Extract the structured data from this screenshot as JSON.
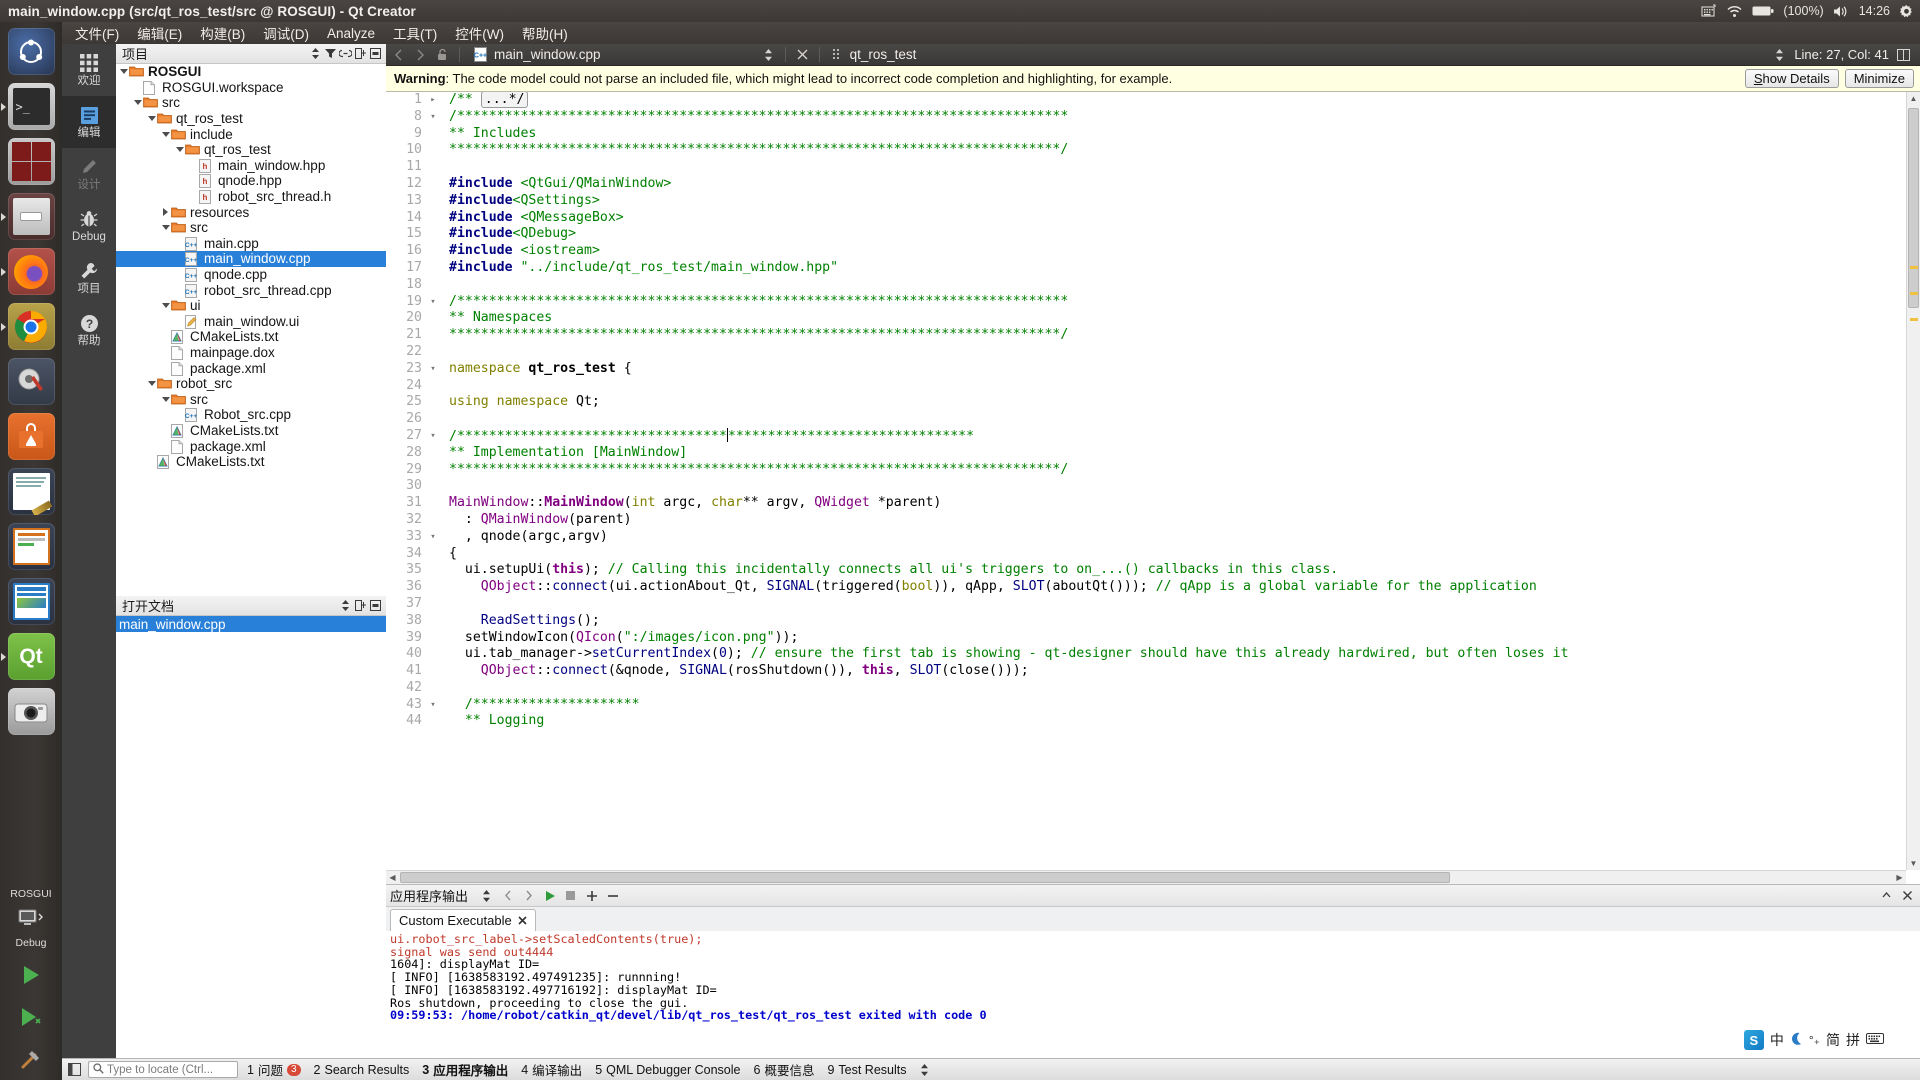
{
  "window": {
    "title": "main_window.cpp (src/qt_ros_test/src @ ROSGUI) - Qt Creator"
  },
  "tray": {
    "keyboard_icon": "keyboard-icon",
    "wifi_icon": "wifi-icon",
    "battery_icon": "battery-icon",
    "battery_label": "(100%)",
    "volume_icon": "volume-icon",
    "clock": "14:26",
    "gear_icon": "gear-icon"
  },
  "launcher": {
    "items": [
      {
        "name": "ubuntu-dash",
        "icon": "ubuntu-logo-icon",
        "running": false
      },
      {
        "name": "terminal",
        "icon": "terminal-icon",
        "running": true
      },
      {
        "name": "terminator",
        "icon": "terminator-icon",
        "running": false
      },
      {
        "name": "files",
        "icon": "file-manager-icon",
        "running": true
      },
      {
        "name": "firefox",
        "icon": "firefox-icon",
        "running": true
      },
      {
        "name": "chrome",
        "icon": "chrome-icon",
        "running": true
      },
      {
        "name": "software-updater",
        "icon": "gear-wrench-icon",
        "running": false
      },
      {
        "name": "ubuntu-software",
        "icon": "software-bag-icon",
        "running": false
      },
      {
        "name": "libreoffice-writer",
        "icon": "writer-icon",
        "running": false
      },
      {
        "name": "libreoffice-impress",
        "icon": "impress-icon",
        "running": false
      },
      {
        "name": "libreoffice-draw",
        "icon": "draw-icon",
        "running": false
      },
      {
        "name": "qt-creator",
        "icon": "qt-icon",
        "running": true
      },
      {
        "name": "camera",
        "icon": "camera-icon",
        "running": false
      }
    ],
    "bottom": {
      "project_label": "ROSGUI",
      "kit_label": "Debug",
      "run_icon": "run-icon",
      "debug_icon": "debug-run-icon",
      "build_icon": "build-hammer-icon"
    }
  },
  "menubar": {
    "items": [
      "文件(F)",
      "编辑(E)",
      "构建(B)",
      "调试(D)",
      "Analyze",
      "工具(T)",
      "控件(W)",
      "帮助(H)"
    ]
  },
  "modes": [
    {
      "label": "欢迎",
      "icon": "grid-icon",
      "state": "normal"
    },
    {
      "label": "编辑",
      "icon": "edit-doc-icon",
      "state": "active"
    },
    {
      "label": "设计",
      "icon": "pencil-icon",
      "state": "disabled"
    },
    {
      "label": "Debug",
      "icon": "bug-icon",
      "state": "normal"
    },
    {
      "label": "项目",
      "icon": "wrench-icon",
      "state": "normal"
    },
    {
      "label": "帮助",
      "icon": "question-icon",
      "state": "normal"
    }
  ],
  "project_dock": {
    "title": "项目",
    "filter_icon": "filter-icon",
    "link_icon": "link-icon",
    "split_icon": "split-icon",
    "close_icon": "close-icon",
    "tree": [
      {
        "depth": 0,
        "expander": "down",
        "icon": "folder-icon",
        "label": "ROSGUI",
        "bold": true,
        "selected": false
      },
      {
        "depth": 1,
        "expander": "none",
        "icon": "file-icon",
        "label": "ROSGUI.workspace",
        "bold": false,
        "selected": false
      },
      {
        "depth": 1,
        "expander": "down",
        "icon": "folder-icon",
        "label": "src",
        "bold": false,
        "selected": false
      },
      {
        "depth": 2,
        "expander": "down",
        "icon": "folder-icon",
        "label": "qt_ros_test",
        "bold": false,
        "selected": false
      },
      {
        "depth": 3,
        "expander": "down",
        "icon": "folder-icon",
        "label": "include",
        "bold": false,
        "selected": false
      },
      {
        "depth": 4,
        "expander": "down",
        "icon": "folder-icon",
        "label": "qt_ros_test",
        "bold": false,
        "selected": false
      },
      {
        "depth": 5,
        "expander": "none",
        "icon": "h-file-icon",
        "label": "main_window.hpp",
        "bold": false,
        "selected": false
      },
      {
        "depth": 5,
        "expander": "none",
        "icon": "h-file-icon",
        "label": "qnode.hpp",
        "bold": false,
        "selected": false
      },
      {
        "depth": 5,
        "expander": "none",
        "icon": "h-file-icon",
        "label": "robot_src_thread.h",
        "bold": false,
        "selected": false
      },
      {
        "depth": 3,
        "expander": "right",
        "icon": "folder-icon",
        "label": "resources",
        "bold": false,
        "selected": false
      },
      {
        "depth": 3,
        "expander": "down",
        "icon": "folder-icon",
        "label": "src",
        "bold": false,
        "selected": false
      },
      {
        "depth": 4,
        "expander": "none",
        "icon": "cpp-file-icon",
        "label": "main.cpp",
        "bold": false,
        "selected": false
      },
      {
        "depth": 4,
        "expander": "none",
        "icon": "cpp-file-icon",
        "label": "main_window.cpp",
        "bold": false,
        "selected": true
      },
      {
        "depth": 4,
        "expander": "none",
        "icon": "cpp-file-icon",
        "label": "qnode.cpp",
        "bold": false,
        "selected": false
      },
      {
        "depth": 4,
        "expander": "none",
        "icon": "cpp-file-icon",
        "label": "robot_src_thread.cpp",
        "bold": false,
        "selected": false
      },
      {
        "depth": 3,
        "expander": "down",
        "icon": "folder-icon",
        "label": "ui",
        "bold": false,
        "selected": false
      },
      {
        "depth": 4,
        "expander": "none",
        "icon": "ui-file-icon",
        "label": "main_window.ui",
        "bold": false,
        "selected": false
      },
      {
        "depth": 3,
        "expander": "none",
        "icon": "cmake-icon",
        "label": "CMakeLists.txt",
        "bold": false,
        "selected": false
      },
      {
        "depth": 3,
        "expander": "none",
        "icon": "file-icon",
        "label": "mainpage.dox",
        "bold": false,
        "selected": false
      },
      {
        "depth": 3,
        "expander": "none",
        "icon": "file-icon",
        "label": "package.xml",
        "bold": false,
        "selected": false
      },
      {
        "depth": 2,
        "expander": "down",
        "icon": "folder-icon",
        "label": "robot_src",
        "bold": false,
        "selected": false
      },
      {
        "depth": 3,
        "expander": "down",
        "icon": "folder-icon",
        "label": "src",
        "bold": false,
        "selected": false
      },
      {
        "depth": 4,
        "expander": "none",
        "icon": "cpp-file-icon",
        "label": "Robot_src.cpp",
        "bold": false,
        "selected": false
      },
      {
        "depth": 3,
        "expander": "none",
        "icon": "cmake-icon",
        "label": "CMakeLists.txt",
        "bold": false,
        "selected": false
      },
      {
        "depth": 3,
        "expander": "none",
        "icon": "file-icon",
        "label": "package.xml",
        "bold": false,
        "selected": false
      },
      {
        "depth": 2,
        "expander": "none",
        "icon": "cmake-icon",
        "label": "CMakeLists.txt",
        "bold": false,
        "selected": false
      }
    ]
  },
  "opendocs_dock": {
    "title": "打开文档",
    "items": [
      {
        "label": "main_window.cpp",
        "selected": true
      }
    ]
  },
  "editor_toolbar": {
    "back_icon": "back-arrow-icon",
    "forward_icon": "forward-arrow-icon",
    "lock_icon": "unlocked-icon",
    "file_icon": "cpp-file-icon",
    "filename": "main_window.cpp",
    "updown_icon": "updown-arrow-icon",
    "close_icon": "close-icon",
    "drag_icon": "drag-handle-icon",
    "symbol": "qt_ros_test",
    "right_updown_icon": "updown-arrow-icon",
    "cursor_position": "Line: 27, Col: 41",
    "split_icon": "split-editor-icon"
  },
  "infobar": {
    "label_bold": "Warning",
    "text": ": The code model could not parse an included file, which might lead to incorrect code completion and highlighting, for example.",
    "show_details": "Show Details",
    "minimize": "Minimize"
  },
  "code": {
    "lines": [
      {
        "num": "1",
        "fold": "right",
        "html": "<span class=\"cmt\">/** </span><span class=\"ellip\">...*/</span>"
      },
      {
        "num": "8",
        "fold": "down",
        "html": "<span class=\"cmt\">/*****************************************************************************</span>"
      },
      {
        "num": "9",
        "fold": "",
        "html": "<span class=\"cmt\">** Includes</span>"
      },
      {
        "num": "10",
        "fold": "",
        "html": "<span class=\"cmt\">*****************************************************************************/</span>"
      },
      {
        "num": "11",
        "fold": "",
        "html": ""
      },
      {
        "num": "12",
        "fold": "",
        "html": "<span class=\"pre\">#include</span><span class=\"plain\"> </span><span class=\"str\">&lt;QtGui/QMainWindow&gt;</span>"
      },
      {
        "num": "13",
        "fold": "",
        "html": "<span class=\"pre\">#include</span><span class=\"str\">&lt;QSettings&gt;</span>"
      },
      {
        "num": "14",
        "fold": "",
        "html": "<span class=\"pre\">#include</span><span class=\"plain\"> </span><span class=\"str\">&lt;QMessageBox&gt;</span>"
      },
      {
        "num": "15",
        "fold": "",
        "html": "<span class=\"pre\">#include</span><span class=\"str\">&lt;QDebug&gt;</span>"
      },
      {
        "num": "16",
        "fold": "",
        "html": "<span class=\"pre\">#include</span><span class=\"plain\"> </span><span class=\"str\">&lt;iostream&gt;</span>"
      },
      {
        "num": "17",
        "fold": "",
        "html": "<span class=\"pre\">#include</span><span class=\"plain\"> </span><span class=\"str\">\"../include/qt_ros_test/main_window.hpp\"</span>"
      },
      {
        "num": "18",
        "fold": "",
        "html": ""
      },
      {
        "num": "19",
        "fold": "down",
        "html": "<span class=\"cmt\">/*****************************************************************************</span>"
      },
      {
        "num": "20",
        "fold": "",
        "html": "<span class=\"cmt\">** Namespaces</span>"
      },
      {
        "num": "21",
        "fold": "",
        "html": "<span class=\"cmt\">*****************************************************************************/</span>"
      },
      {
        "num": "22",
        "fold": "",
        "html": ""
      },
      {
        "num": "23",
        "fold": "down",
        "html": "<span class=\"kw\">namespace</span><span class=\"plain\"> </span><span class=\"plain\" style=\"font-weight:bold\">qt_ros_test</span><span class=\"plain\"> {</span>"
      },
      {
        "num": "24",
        "fold": "",
        "html": ""
      },
      {
        "num": "25",
        "fold": "",
        "html": "<span class=\"kw\">using namespace</span><span class=\"plain\"> Qt;</span>"
      },
      {
        "num": "26",
        "fold": "",
        "html": ""
      },
      {
        "num": "27",
        "fold": "down",
        "html": "<span class=\"cmt\">/**********************************</span><span class=\"caret\"></span><span class=\"cmt\">*******************************</span>"
      },
      {
        "num": "28",
        "fold": "",
        "html": "<span class=\"cmt\">** Implementation [MainWindow]</span>"
      },
      {
        "num": "29",
        "fold": "",
        "html": "<span class=\"cmt\">*****************************************************************************/</span>"
      },
      {
        "num": "30",
        "fold": "",
        "html": ""
      },
      {
        "num": "31",
        "fold": "",
        "html": "<span class=\"typ\">MainWindow</span><span class=\"plain\">::</span><span class=\"typ\" style=\"font-weight:bold\">MainWindow</span><span class=\"plain\">(</span><span class=\"kw\">int</span><span class=\"plain\"> argc, </span><span class=\"kw\">char</span><span class=\"plain\">** argv, </span><span class=\"typ\">QWidget</span><span class=\"plain\"> *parent)</span>"
      },
      {
        "num": "32",
        "fold": "",
        "html": "<span class=\"plain\">  : </span><span class=\"typ\">QMainWindow</span><span class=\"plain\">(parent)</span>"
      },
      {
        "num": "33",
        "fold": "down",
        "html": "<span class=\"plain\">  , qnode(argc,argv)</span>"
      },
      {
        "num": "34",
        "fold": "",
        "html": "<span class=\"plain\">{</span>"
      },
      {
        "num": "35",
        "fold": "",
        "html": "<span class=\"plain\">  ui.setupUi(</span><span class=\"kw2\">this</span><span class=\"plain\">); </span><span class=\"cmt\">// Calling this incidentally connects all ui's triggers to on_...() callbacks in this class.</span>"
      },
      {
        "num": "36",
        "fold": "",
        "html": "<span class=\"plain\">    </span><span class=\"typ\">QObject</span><span class=\"plain\">::</span><span class=\"fn\">connect</span><span class=\"plain\">(ui.actionAbout_Qt, </span><span class=\"fn\">SIGNAL</span><span class=\"plain\">(triggered(</span><span class=\"kw\">bool</span><span class=\"plain\">)), qApp, </span><span class=\"fn\">SLOT</span><span class=\"plain\">(aboutQt())); </span><span class=\"cmt\">// qApp is a global variable for the application</span>"
      },
      {
        "num": "37",
        "fold": "",
        "html": ""
      },
      {
        "num": "38",
        "fold": "",
        "html": "<span class=\"plain\">    </span><span class=\"fn\">ReadSettings</span><span class=\"plain\">();</span>"
      },
      {
        "num": "39",
        "fold": "",
        "html": "<span class=\"plain\">  setWindowIcon(</span><span class=\"typ\">QIcon</span><span class=\"plain\">(</span><span class=\"str\">\":/images/icon.png\"</span><span class=\"plain\">));</span>"
      },
      {
        "num": "40",
        "fold": "",
        "html": "<span class=\"plain\">  ui.tab_manager-&gt;</span><span class=\"fn\">setCurrentIndex</span><span class=\"plain\">(</span><span class=\"num\">0</span><span class=\"plain\">); </span><span class=\"cmt\">// ensure the first tab is showing - qt-designer should have this already hardwired, but often loses it</span>"
      },
      {
        "num": "41",
        "fold": "",
        "html": "<span class=\"plain\">    </span><span class=\"typ\">QObject</span><span class=\"plain\">::</span><span class=\"fn\">connect</span><span class=\"plain\">(&amp;qnode, </span><span class=\"fn\">SIGNAL</span><span class=\"plain\">(rosShutdown()), </span><span class=\"kw2\">this</span><span class=\"plain\">, </span><span class=\"fn\">SLOT</span><span class=\"plain\">(close()));</span>"
      },
      {
        "num": "42",
        "fold": "",
        "html": ""
      },
      {
        "num": "43",
        "fold": "down",
        "html": "<span class=\"cmt\">  /*********************</span>"
      },
      {
        "num": "44",
        "fold": "",
        "html": "<span class=\"cmt\">  ** Logging</span>"
      }
    ]
  },
  "output_pane": {
    "title": "应用程序输出",
    "toolbar_icons": [
      "updown-arrow-icon",
      "prev-icon",
      "next-icon",
      "run-icon",
      "stop-icon",
      "plus-icon",
      "minus-icon"
    ],
    "tab_label": "Custom Executable",
    "tab_close_icon": "close-icon",
    "maximize_icon": "maximize-icon",
    "close_icon": "close-icon",
    "lines": [
      {
        "text": "ui.robot_src_label->setScaledContents(true);",
        "color": "#c0392b"
      },
      {
        "text": "signal was send out4444",
        "color": "#c0392b"
      },
      {
        "text": "1604]: displayMat ID=",
        "color": "#000000"
      },
      {
        "text": "[ INFO] [1638583192.497491235]: runnning!",
        "color": "#000000"
      },
      {
        "text": "[ INFO] [1638583192.497716192]: displayMat ID=",
        "color": "#000000"
      },
      {
        "text": "Ros shutdown, proceeding to close the gui.",
        "color": "#000000"
      },
      {
        "text": "09:59:53: /home/robot/catkin_qt/devel/lib/qt_ros_test/qt_ros_test exited with code 0",
        "color": "#0000cc"
      }
    ]
  },
  "statusbar": {
    "sidebar_toggle_icon": "sidebar-toggle-icon",
    "locate_icon": "search-icon",
    "locate_placeholder": "Type to locate (Ctrl...",
    "items": [
      {
        "num": "1",
        "label": "问题",
        "badge": "3"
      },
      {
        "num": "2",
        "label": "Search Results",
        "badge": ""
      },
      {
        "num": "3",
        "label": "应用程序输出",
        "badge": "",
        "active": true
      },
      {
        "num": "4",
        "label": "编译输出",
        "badge": ""
      },
      {
        "num": "5",
        "label": "QML Debugger Console",
        "badge": ""
      },
      {
        "num": "6",
        "label": "概要信息",
        "badge": ""
      },
      {
        "num": "9",
        "label": "Test Results",
        "badge": ""
      }
    ],
    "updown_icon": "updown-arrow-icon"
  },
  "ime": {
    "logo_text": "S",
    "mode_cn": "中",
    "moon_icon": "moon-icon",
    "tone_icon": "tone-icon",
    "simplified": "简",
    "pinyin": "拼",
    "keyboard_icon": "keyboard-icon"
  },
  "colors": {
    "accent_blue": "#2980d9",
    "panel_dark": "#3c3835",
    "warning_bg": "#ffffe1",
    "mode_bg": "#3f3f3f"
  }
}
